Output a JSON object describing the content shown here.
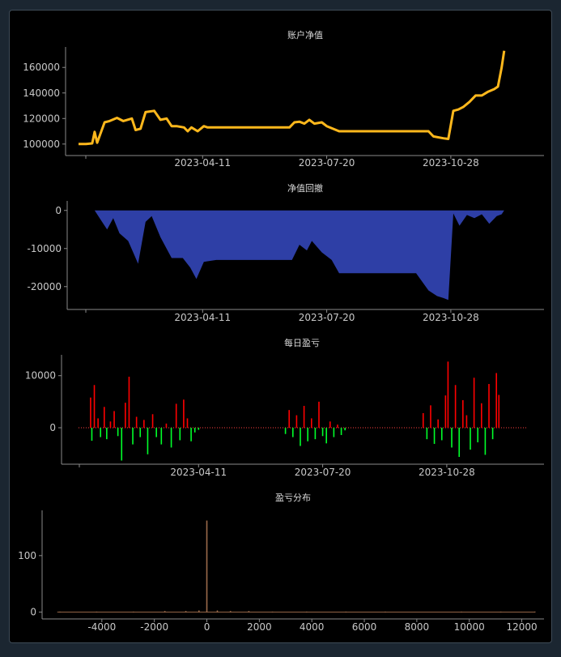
{
  "chart_data": [
    {
      "type": "line",
      "title": "账户净值",
      "x_ticks": [
        "2023-04-11",
        "2023-07-20",
        "2023-10-28"
      ],
      "y_ticks": [
        100000,
        120000,
        140000,
        160000
      ],
      "color": "#ffb81c",
      "x_range": [
        "2023-01-01",
        "2023-12-31"
      ],
      "ylim": [
        91000,
        176000
      ],
      "x": [
        "2023-01-01",
        "2023-01-07",
        "2023-01-12",
        "2023-01-14",
        "2023-01-16",
        "2023-01-22",
        "2023-01-26",
        "2023-02-01",
        "2023-02-06",
        "2023-02-13",
        "2023-02-16",
        "2023-02-20",
        "2023-02-24",
        "2023-03-03",
        "2023-03-08",
        "2023-03-13",
        "2023-03-17",
        "2023-03-21",
        "2023-03-27",
        "2023-03-30",
        "2023-04-02",
        "2023-04-07",
        "2023-04-12",
        "2023-04-15",
        "2023-04-30",
        "2023-05-31",
        "2023-06-20",
        "2023-06-24",
        "2023-06-28",
        "2023-07-02",
        "2023-07-06",
        "2023-07-10",
        "2023-07-16",
        "2023-07-20",
        "2023-07-30",
        "2023-08-31",
        "2023-09-30",
        "2023-10-10",
        "2023-10-14",
        "2023-10-22",
        "2023-10-26",
        "2023-10-30",
        "2023-11-03",
        "2023-11-07",
        "2023-11-12",
        "2023-11-17",
        "2023-11-22",
        "2023-11-27",
        "2023-12-02",
        "2023-12-05",
        "2023-12-08",
        "2023-12-10"
      ],
      "values": [
        100000,
        100000,
        100500,
        109500,
        101000,
        117000,
        118000,
        120500,
        118000,
        120000,
        111000,
        112000,
        125000,
        126000,
        119000,
        120000,
        114000,
        114000,
        113000,
        110000,
        113000,
        110000,
        114000,
        113000,
        113000,
        113000,
        113000,
        117000,
        117500,
        116000,
        119000,
        116000,
        117000,
        114000,
        110000,
        110000,
        110000,
        110000,
        106000,
        104500,
        104000,
        126000,
        127000,
        129000,
        133000,
        138000,
        138000,
        141000,
        143000,
        145000,
        160000,
        173000
      ]
    },
    {
      "type": "area",
      "title": "净值回撤",
      "x_ticks": [
        "2023-04-11",
        "2023-07-20",
        "2023-10-28"
      ],
      "y_ticks": [
        0,
        -10000,
        -20000
      ],
      "color": "#2e3fa6",
      "x_range": [
        "2023-01-01",
        "2023-12-31"
      ],
      "ylim": [
        -26000,
        2500
      ],
      "x": [
        "2023-01-01",
        "2023-01-14",
        "2023-01-20",
        "2023-01-24",
        "2023-01-29",
        "2023-02-03",
        "2023-02-10",
        "2023-02-14",
        "2023-02-18",
        "2023-02-24",
        "2023-03-01",
        "2023-03-08",
        "2023-03-17",
        "2023-03-26",
        "2023-04-01",
        "2023-04-06",
        "2023-04-12",
        "2023-04-22",
        "2023-05-31",
        "2023-06-22",
        "2023-06-28",
        "2023-07-04",
        "2023-07-08",
        "2023-07-16",
        "2023-07-24",
        "2023-07-30",
        "2023-08-31",
        "2023-09-30",
        "2023-10-10",
        "2023-10-17",
        "2023-10-22",
        "2023-10-26",
        "2023-10-30",
        "2023-11-04",
        "2023-11-10",
        "2023-11-16",
        "2023-11-22",
        "2023-11-28",
        "2023-12-04",
        "2023-12-08",
        "2023-12-10"
      ],
      "values": [
        0,
        0,
        -3000,
        -5000,
        -2000,
        -6000,
        -8000,
        -11000,
        -14000,
        -3000,
        -1500,
        -7000,
        -12500,
        -12500,
        -15000,
        -18000,
        -13500,
        -13000,
        -13000,
        -13000,
        -9000,
        -10500,
        -8000,
        -11000,
        -13000,
        -16500,
        -16500,
        -16500,
        -21000,
        -22500,
        -23000,
        -23500,
        -800,
        -4000,
        -1200,
        -2000,
        -1000,
        -3500,
        -1500,
        -1000,
        0
      ]
    },
    {
      "type": "bar",
      "title": "每日盈亏",
      "x_ticks": [
        "2023-04-11",
        "2023-07-20",
        "2023-10-28"
      ],
      "y_ticks": [
        0,
        10000
      ],
      "positive_color": "#ff0000",
      "negative_color": "#00ff2a",
      "zero_line_color": "#ff4040",
      "x_range": [
        "2023-01-01",
        "2023-12-31"
      ],
      "ylim": [
        -7000,
        14000
      ],
      "x": [
        "2023-01-14",
        "2023-01-15",
        "2023-01-17",
        "2023-01-20",
        "2023-01-22",
        "2023-01-25",
        "2023-01-27",
        "2023-01-30",
        "2023-02-02",
        "2023-02-05",
        "2023-02-08",
        "2023-02-11",
        "2023-02-14",
        "2023-02-17",
        "2023-02-20",
        "2023-02-23",
        "2023-02-26",
        "2023-03-01",
        "2023-03-05",
        "2023-03-08",
        "2023-03-12",
        "2023-03-16",
        "2023-03-20",
        "2023-03-24",
        "2023-03-27",
        "2023-03-30",
        "2023-04-02",
        "2023-04-05",
        "2023-04-08",
        "2023-04-11",
        "2023-06-20",
        "2023-06-23",
        "2023-06-26",
        "2023-06-29",
        "2023-07-02",
        "2023-07-05",
        "2023-07-08",
        "2023-07-11",
        "2023-07-14",
        "2023-07-17",
        "2023-07-20",
        "2023-07-23",
        "2023-07-26",
        "2023-07-29",
        "2023-08-01",
        "2023-08-04",
        "2023-08-07",
        "2023-10-09",
        "2023-10-12",
        "2023-10-15",
        "2023-10-18",
        "2023-10-21",
        "2023-10-24",
        "2023-10-27",
        "2023-10-29",
        "2023-11-01",
        "2023-11-04",
        "2023-11-07",
        "2023-11-10",
        "2023-11-13",
        "2023-11-16",
        "2023-11-19",
        "2023-11-22",
        "2023-11-25",
        "2023-11-28",
        "2023-12-01",
        "2023-12-04",
        "2023-12-07",
        "2023-12-09"
      ],
      "values": [
        5800,
        -2500,
        8200,
        1800,
        -1800,
        4000,
        -2200,
        1200,
        3200,
        -1600,
        -6300,
        4800,
        9800,
        -3200,
        2100,
        -1800,
        1500,
        -5100,
        2600,
        -1800,
        -3200,
        800,
        -3800,
        4600,
        -2400,
        5400,
        1800,
        -2600,
        -900,
        -400,
        -1200,
        3400,
        -1800,
        2400,
        -3500,
        4200,
        -2600,
        1800,
        -2200,
        5000,
        -1600,
        -3000,
        1200,
        -1800,
        600,
        -1400,
        -500,
        2800,
        -2200,
        4300,
        -3100,
        1600,
        -2400,
        6200,
        12700,
        -3800,
        8200,
        -5600,
        5300,
        2400,
        -4200,
        9600,
        -2800,
        4700,
        -5200,
        8400,
        -2200,
        10500,
        6300
      ]
    },
    {
      "type": "bar",
      "title": "盈亏分布",
      "x_ticks": [
        -4000,
        -2000,
        0,
        2000,
        4000,
        6000,
        8000,
        10000,
        12000
      ],
      "y_ticks": [
        0,
        100
      ],
      "color": "#9a6a4a",
      "xlim": [
        -6000,
        12600
      ],
      "ylim": [
        -12,
        180
      ],
      "x": [
        -5600,
        -4200,
        -2800,
        -1600,
        -800,
        -300,
        0,
        400,
        900,
        1600,
        2500,
        3800,
        5300,
        6800,
        8200,
        9700,
        11200,
        12500
      ],
      "values": [
        1,
        1,
        1,
        2,
        2,
        3,
        162,
        3,
        2,
        2,
        1,
        1,
        1,
        1,
        0,
        1,
        1,
        1
      ]
    }
  ]
}
